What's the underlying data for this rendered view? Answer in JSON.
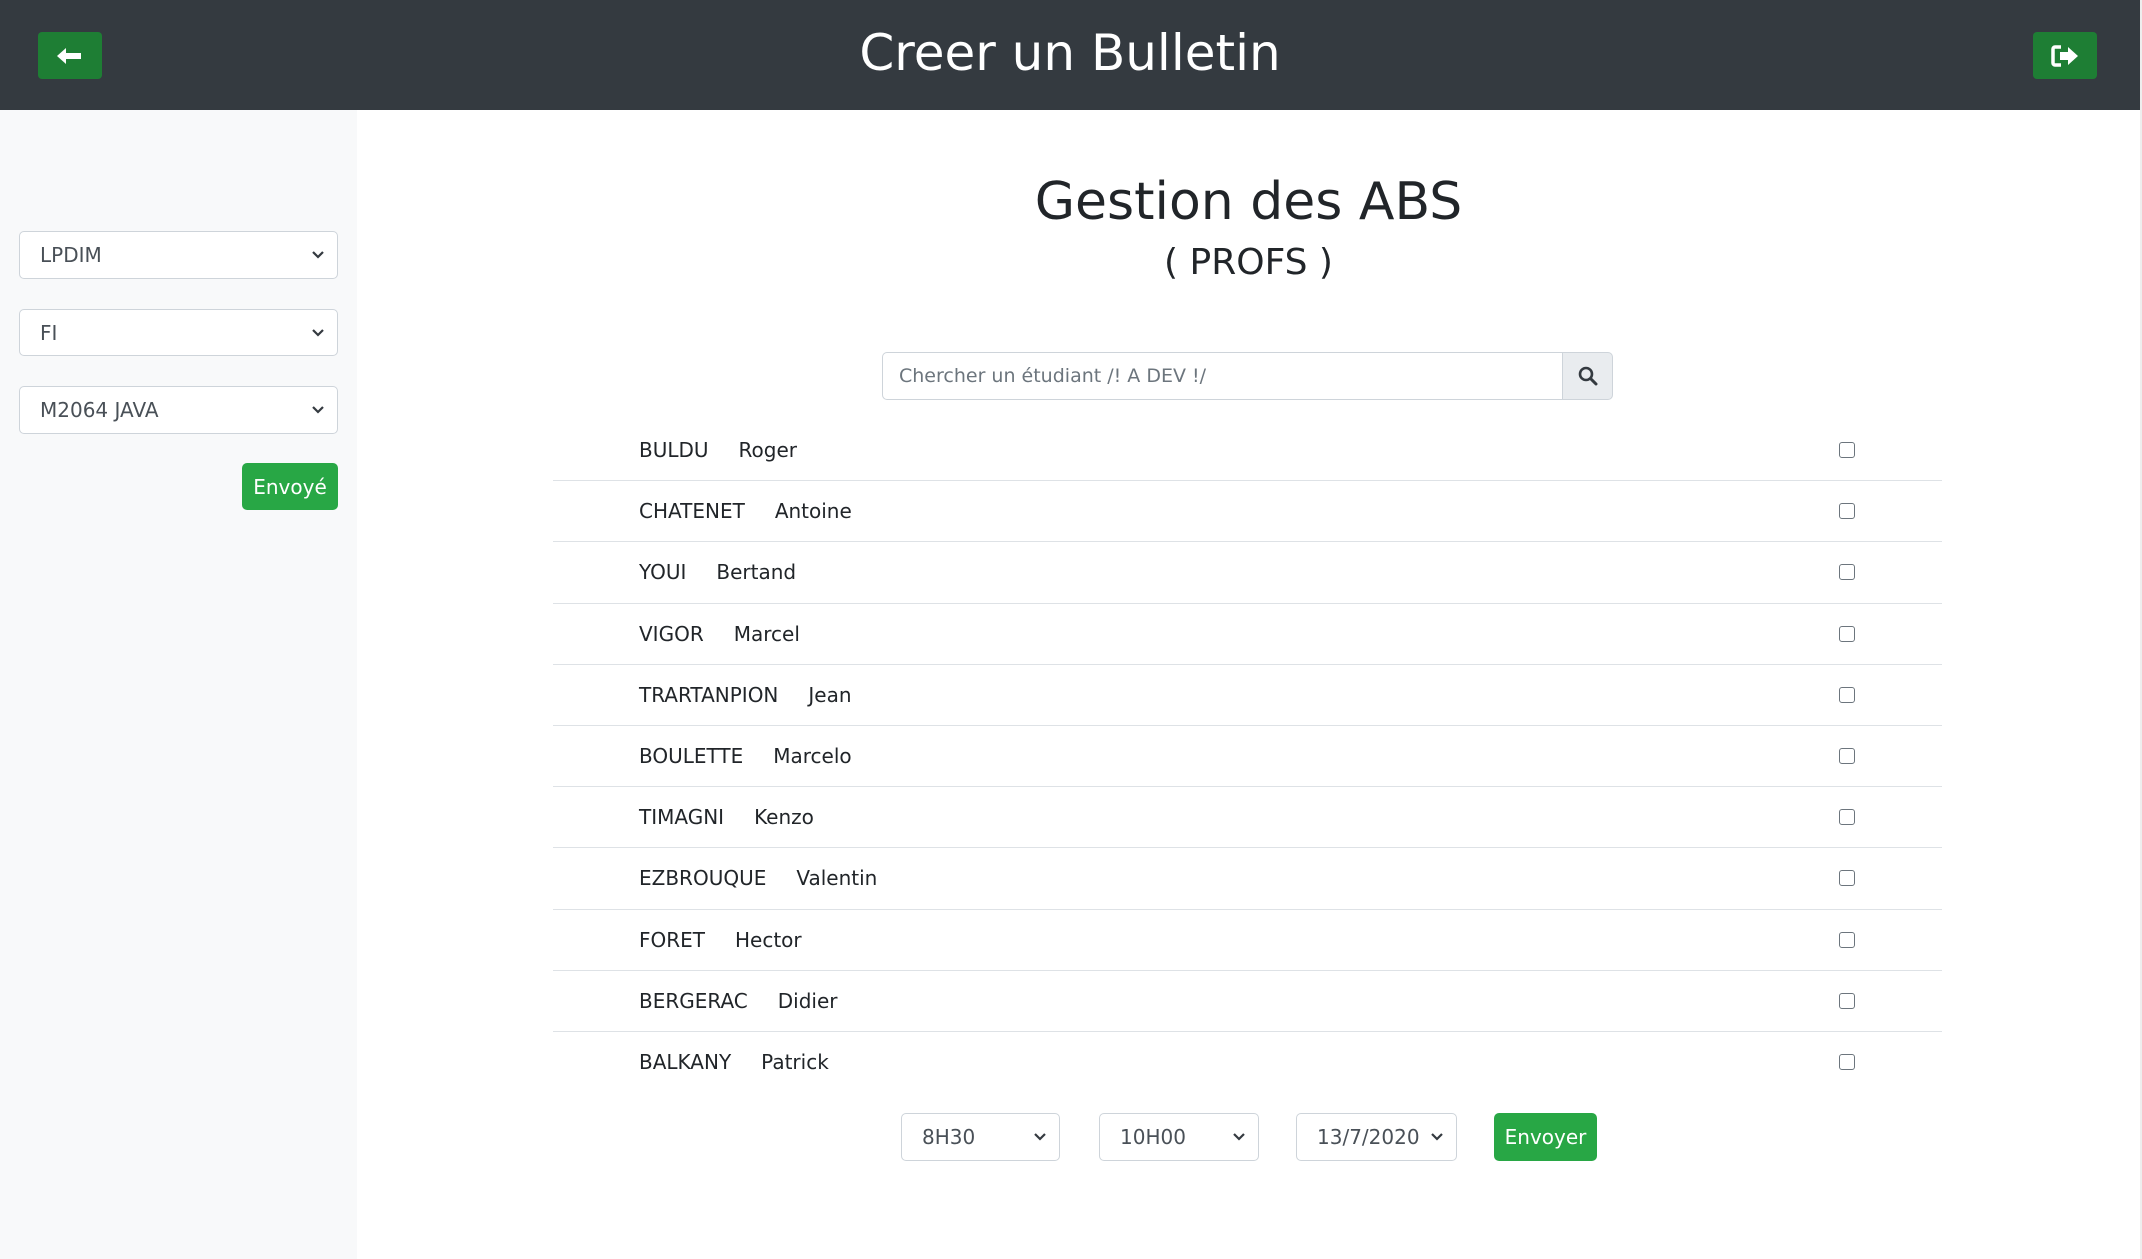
{
  "header": {
    "title": "Creer un Bulletin",
    "back_icon": "arrow-left-icon",
    "logout_icon": "sign-out-icon"
  },
  "sidebar": {
    "formation_select": "LPDIM",
    "type_select": "FI",
    "module_select": "M2064 JAVA",
    "submit_label": "Envoyé"
  },
  "main": {
    "title": "Gestion des ABS",
    "subtitle": "( PROFS )",
    "search": {
      "placeholder": "Chercher un étudiant /! A DEV !/",
      "value": "",
      "icon": "search-icon"
    },
    "students": [
      {
        "last_name": "BULDU",
        "first_name": "Roger",
        "checked": false
      },
      {
        "last_name": "CHATENET",
        "first_name": "Antoine",
        "checked": false
      },
      {
        "last_name": "YOUI",
        "first_name": "Bertand",
        "checked": false
      },
      {
        "last_name": "VIGOR",
        "first_name": "Marcel",
        "checked": false
      },
      {
        "last_name": "TRARTANPION",
        "first_name": "Jean",
        "checked": false
      },
      {
        "last_name": "BOULETTE",
        "first_name": "Marcelo",
        "checked": false
      },
      {
        "last_name": "TIMAGNI",
        "first_name": "Kenzo",
        "checked": false
      },
      {
        "last_name": "EZBROUQUE",
        "first_name": "Valentin",
        "checked": false
      },
      {
        "last_name": "FORET",
        "first_name": "Hector",
        "checked": false
      },
      {
        "last_name": "BERGERAC",
        "first_name": "Didier",
        "checked": false
      },
      {
        "last_name": "BALKANY",
        "first_name": "Patrick",
        "checked": false
      }
    ],
    "footer": {
      "start_time": "8H30",
      "end_time": "10H00",
      "date": "13/7/2020",
      "submit_label": "Envoyer"
    }
  },
  "colors": {
    "header_bg": "#343a40",
    "header_button": "#1e7e34",
    "primary_button": "#28a745",
    "sidebar_bg": "#f8f9fa"
  }
}
